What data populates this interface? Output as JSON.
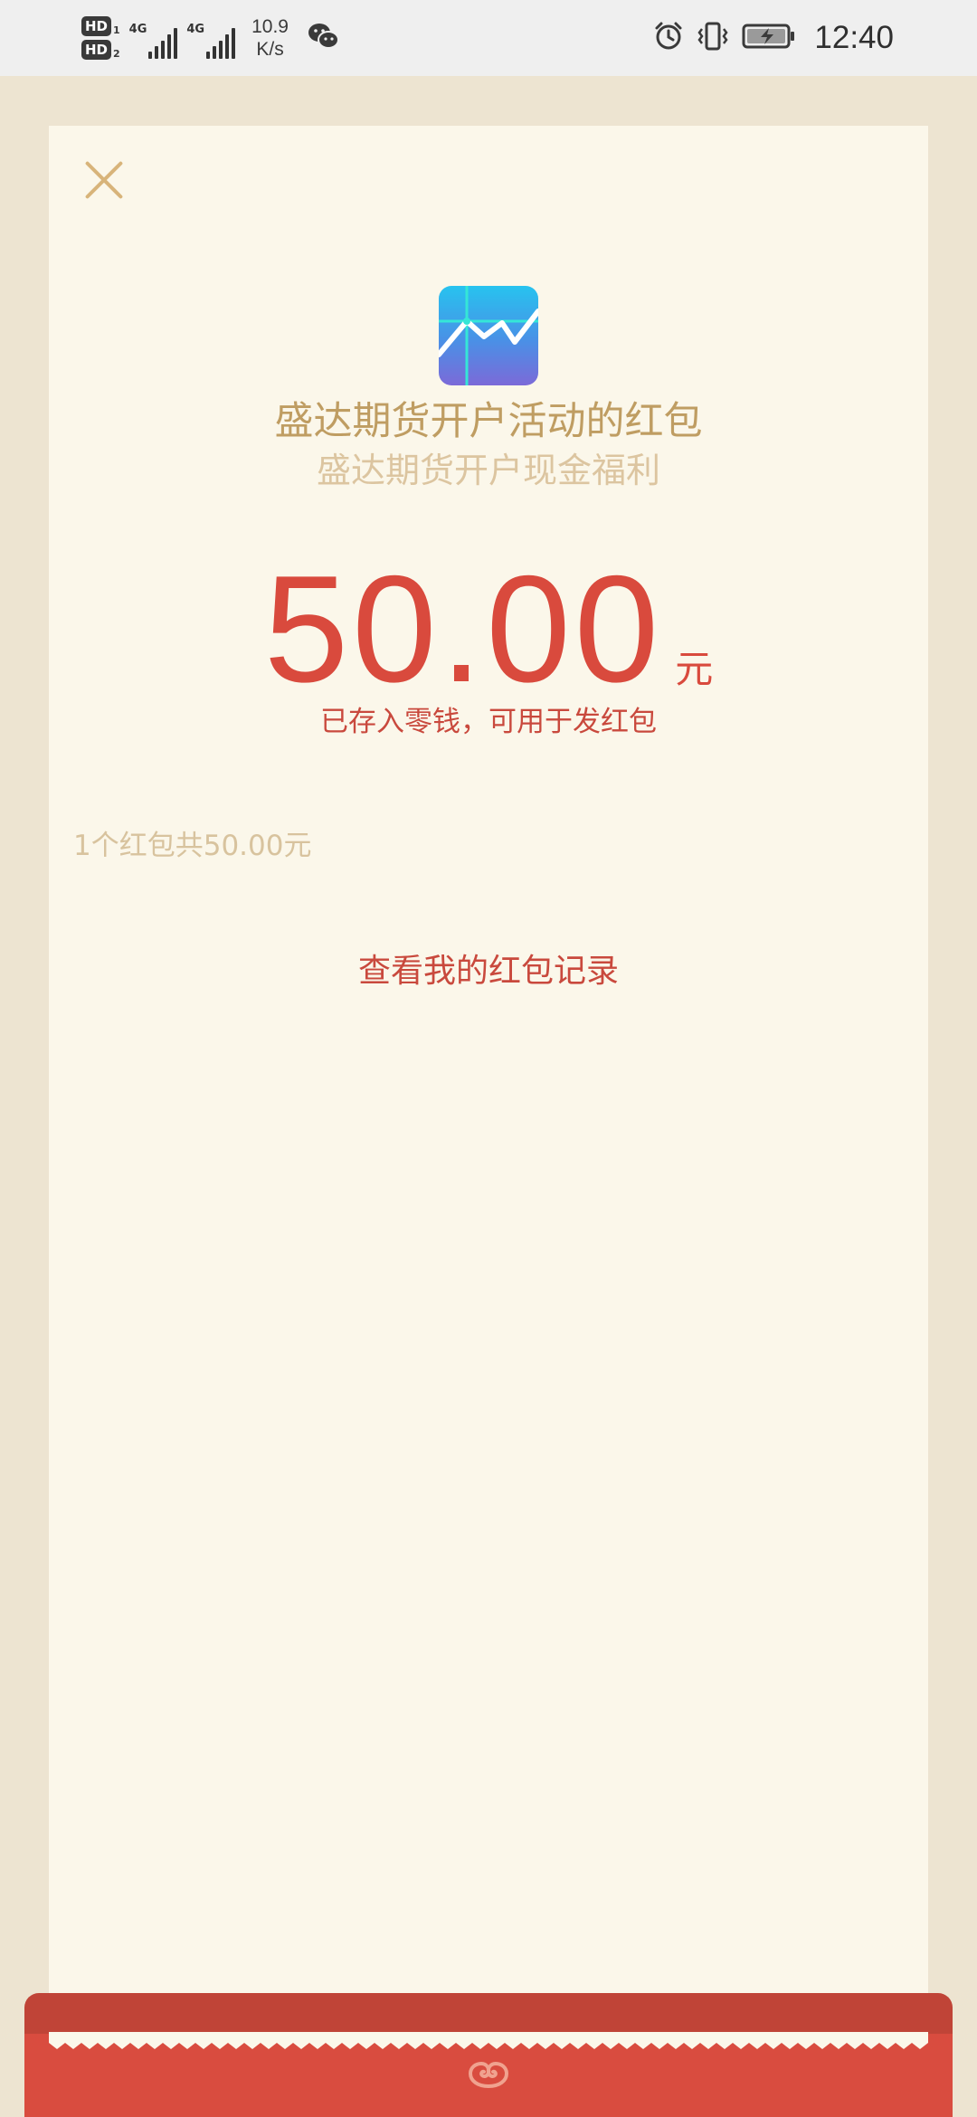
{
  "status_bar": {
    "hd1": "HD",
    "hd1_sub": "1",
    "hd2": "HD",
    "hd2_sub": "2",
    "network1": "4G",
    "network2": "4G",
    "speed_value": "10.9",
    "speed_unit": "K/s",
    "time": "12:40",
    "icons": [
      "alarm-icon",
      "vibrate-icon",
      "battery-charging-icon",
      "wechat-icon"
    ]
  },
  "card": {
    "sender_title": "盛达期货开户活动的红包",
    "greeting": "盛达期货开户现金福利",
    "amount": "50.00",
    "amount_unit": "元",
    "deposit_note": "已存入零钱，可用于发红包",
    "summary": "1个红包共50.00元",
    "records_link": "查看我的红包记录"
  },
  "colors": {
    "background": "#ede4d1",
    "card": "#fbf7ea",
    "gold": "#bf9d62",
    "red": "#d94a3d",
    "envelope_red": "#d94c3f"
  }
}
